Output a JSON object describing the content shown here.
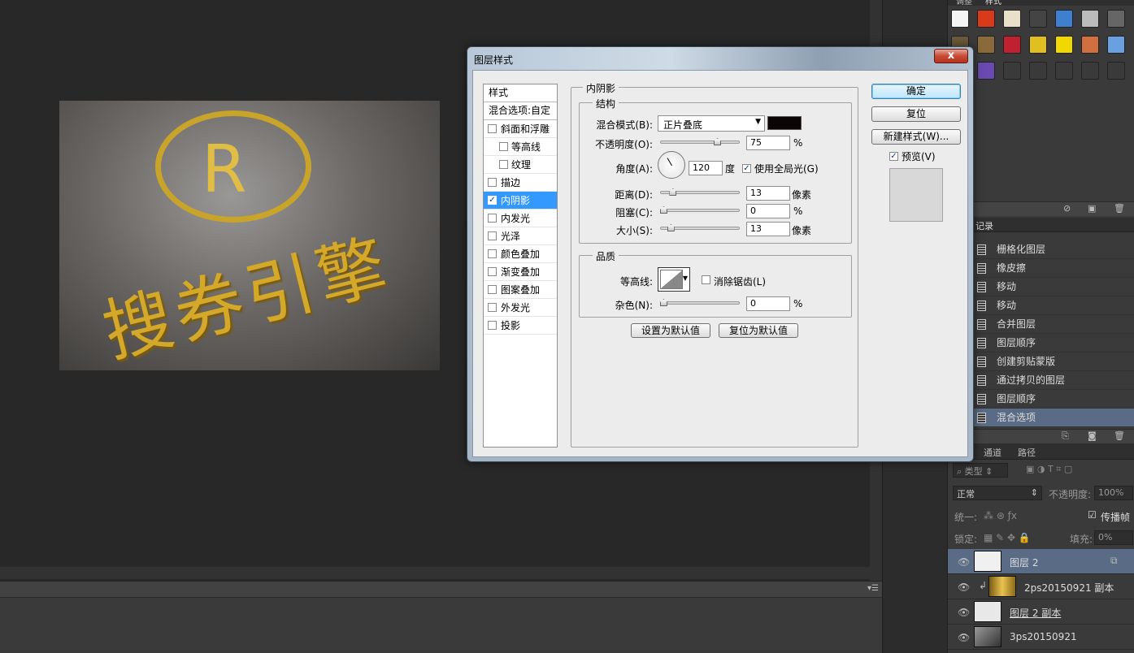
{
  "app": {
    "name": "Photoshop"
  },
  "canvas": {
    "brand_text": "搜券引擎",
    "logo_letter": "R"
  },
  "right_panel": {
    "styles_tabs": [
      "调整",
      "样式"
    ],
    "history": {
      "tab": "记录",
      "items": [
        "栅格化图层",
        "橡皮擦",
        "移动",
        "移动",
        "合并图层",
        "图层顺序",
        "创建剪贴蒙版",
        "通过拷贝的图层",
        "图层顺序",
        "混合选项"
      ],
      "selected_index": 9
    },
    "layers": {
      "tabs": [
        "通道",
        "路径"
      ],
      "filter_label": "类型",
      "blend_mode": "正常",
      "opacity_label": "不透明度:",
      "opacity_value": "100%",
      "unify_label": "统一:",
      "propagate_label": "传播帧",
      "lock_label": "锁定:",
      "fill_label": "填充:",
      "fill_value": "0%",
      "rows": [
        {
          "name": "图层 2",
          "selected": true
        },
        {
          "name": "2ps20150921 副本",
          "selected": false
        },
        {
          "name": "图层 2 副本",
          "selected": false
        },
        {
          "name": "3ps20150921",
          "selected": false
        }
      ]
    }
  },
  "dialog": {
    "title": "图层样式",
    "close_label": "x",
    "style_list": {
      "header": "样式",
      "blend_options": "混合选项:自定",
      "items": [
        {
          "label": "斜面和浮雕",
          "checked": false,
          "sub": false
        },
        {
          "label": "等高线",
          "checked": false,
          "sub": true
        },
        {
          "label": "纹理",
          "checked": false,
          "sub": true
        },
        {
          "label": "描边",
          "checked": false,
          "sub": false
        },
        {
          "label": "内阴影",
          "checked": true,
          "sub": false,
          "selected": true
        },
        {
          "label": "内发光",
          "checked": false,
          "sub": false
        },
        {
          "label": "光泽",
          "checked": false,
          "sub": false
        },
        {
          "label": "颜色叠加",
          "checked": false,
          "sub": false
        },
        {
          "label": "渐变叠加",
          "checked": false,
          "sub": false
        },
        {
          "label": "图案叠加",
          "checked": false,
          "sub": false
        },
        {
          "label": "外发光",
          "checked": false,
          "sub": false
        },
        {
          "label": "投影",
          "checked": false,
          "sub": false
        }
      ]
    },
    "panel_title": "内阴影",
    "structure": {
      "title": "结构",
      "blend_mode_label": "混合模式(B):",
      "blend_mode_value": "正片叠底",
      "color": "#0b0506",
      "opacity_label": "不透明度(O):",
      "opacity_value": "75",
      "opacity_fraction": 0.75,
      "percent": "%",
      "angle_label": "角度(A):",
      "angle_value": "120",
      "angle_unit": "度",
      "global_light_label": "使用全局光(G)",
      "global_light_checked": true,
      "distance_label": "距离(D):",
      "distance_value": "13",
      "distance_fraction": 0.13,
      "choke_label": "阻塞(C):",
      "choke_value": "0",
      "choke_fraction": 0,
      "size_label": "大小(S):",
      "size_value": "13",
      "size_fraction": 0.1,
      "pixels_unit": "像素"
    },
    "quality": {
      "title": "品质",
      "contour_label": "等高线:",
      "antialias_label": "消除锯齿(L)",
      "antialias_checked": false,
      "noise_label": "杂色(N):",
      "noise_value": "0",
      "noise_fraction": 0
    },
    "set_default_label": "设置为默认值",
    "reset_default_label": "复位为默认值",
    "ok_label": "确定",
    "reset_label": "复位",
    "new_style_label": "新建样式(W)...",
    "preview_label": "预览(V)",
    "preview_checked": true
  }
}
